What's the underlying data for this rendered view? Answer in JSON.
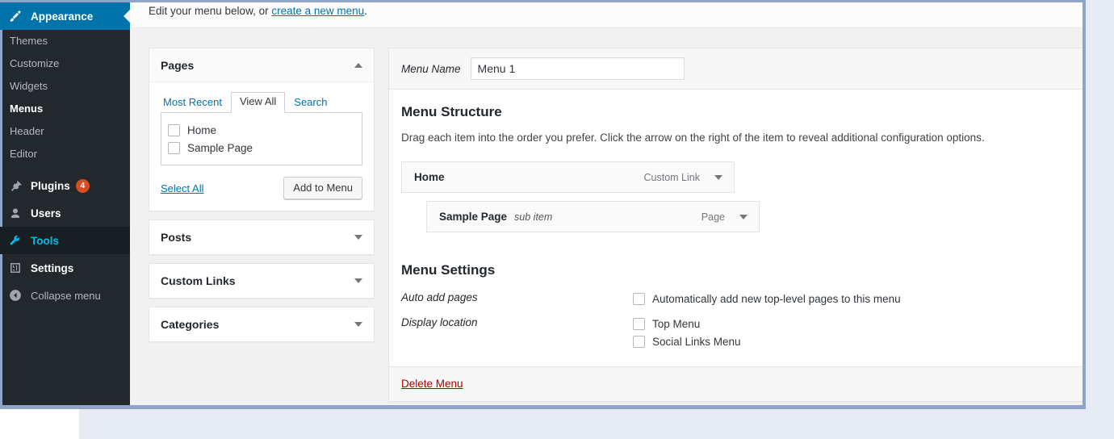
{
  "sidebar": {
    "appearance": {
      "label": "Appearance",
      "icon": "paintbrush-icon",
      "active_color": "#0073aa",
      "submenu": [
        {
          "label": "Themes",
          "current": false
        },
        {
          "label": "Customize",
          "current": false
        },
        {
          "label": "Widgets",
          "current": false
        },
        {
          "label": "Menus",
          "current": true
        },
        {
          "label": "Header",
          "current": false
        },
        {
          "label": "Editor",
          "current": false
        }
      ]
    },
    "items": [
      {
        "label": "Plugins",
        "icon": "plug-icon",
        "badge": "4",
        "state": "normal"
      },
      {
        "label": "Users",
        "icon": "user-icon",
        "badge": "",
        "state": "normal"
      },
      {
        "label": "Tools",
        "icon": "wrench-icon",
        "badge": "",
        "state": "hovered"
      },
      {
        "label": "Settings",
        "icon": "sliders-icon",
        "badge": "",
        "state": "normal"
      }
    ],
    "collapse": {
      "label": "Collapse menu",
      "icon": "collapse-arrow-icon"
    },
    "badge_color": "#d54e21",
    "hover_color": "#00b9eb"
  },
  "notice": {
    "text_before": "Edit your menu below, or ",
    "link": "create a new menu",
    "text_after": "."
  },
  "accordions": [
    {
      "title": "Pages",
      "open": true,
      "toggle": "chevron-up-icon"
    },
    {
      "title": "Posts",
      "open": false,
      "toggle": "chevron-down-icon"
    },
    {
      "title": "Custom Links",
      "open": false,
      "toggle": "chevron-down-icon"
    },
    {
      "title": "Categories",
      "open": false,
      "toggle": "chevron-down-icon"
    }
  ],
  "pages_panel": {
    "tabs": [
      {
        "label": "Most Recent",
        "active": false
      },
      {
        "label": "View All",
        "active": true
      },
      {
        "label": "Search",
        "active": false
      }
    ],
    "checkboxes": [
      {
        "label": "Home",
        "checked": false
      },
      {
        "label": "Sample Page",
        "checked": false
      }
    ],
    "select_all": "Select All",
    "add_button": "Add to Menu"
  },
  "menu_name": {
    "label": "Menu Name",
    "value": "Menu 1",
    "placeholder": "Menu Name"
  },
  "structure": {
    "title": "Menu Structure",
    "description": "Drag each item into the order you prefer. Click the arrow on the right of the item to reveal additional configuration options.",
    "items": [
      {
        "title": "Home",
        "sub_label": "",
        "type": "Custom Link",
        "depth": 0
      },
      {
        "title": "Sample Page",
        "sub_label": "sub item",
        "type": "Page",
        "depth": 1
      }
    ]
  },
  "settings": {
    "title": "Menu Settings",
    "rows": [
      {
        "label": "Auto add pages",
        "options": [
          {
            "label": "Automatically add new top-level pages to this menu",
            "checked": false
          }
        ]
      },
      {
        "label": "Display location",
        "options": [
          {
            "label": "Top Menu",
            "checked": false
          },
          {
            "label": "Social Links Menu",
            "checked": false
          }
        ]
      }
    ]
  },
  "footer": {
    "delete_label": "Delete Menu",
    "delete_color": "#a00"
  }
}
